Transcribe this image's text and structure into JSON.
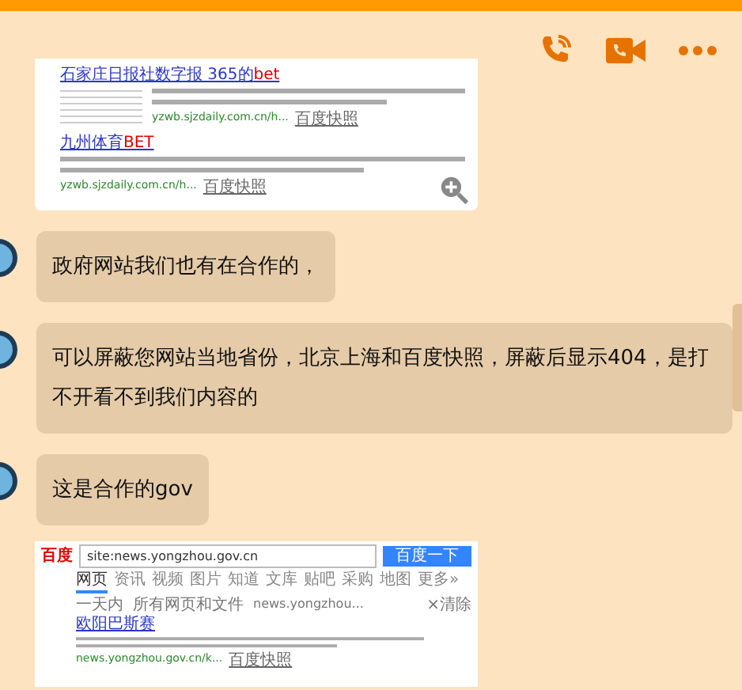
{
  "messages": [
    {
      "kind": "image",
      "shot": {
        "kind": "results",
        "results": [
          {
            "title": "石家庄日报社数字报 365的",
            "title_mark": "bet",
            "has_thumb": true,
            "url": "yzwb.sjzdaily.com.cn/h...",
            "cache": "百度快照"
          },
          {
            "title": "九州体育",
            "title_mark": "BET",
            "has_thumb": false,
            "url": "yzwb.sjzdaily.com.cn/h...",
            "cache": "百度快照"
          }
        ]
      }
    },
    {
      "kind": "text",
      "text": "政府网站我们也有在合作的，"
    },
    {
      "kind": "text",
      "text": "可以屏蔽您网站当地省份，北京上海和百度快照，屏蔽后显示404，是打不开看不到我们内容的"
    },
    {
      "kind": "text",
      "text": "这是合作的gov"
    },
    {
      "kind": "image",
      "shot": {
        "kind": "search",
        "logo": "百度",
        "query": "site:news.yongzhou.gov.cn",
        "button": "百度一下",
        "tabs": [
          {
            "label": "网页",
            "selected": true
          },
          {
            "label": "资讯",
            "selected": false
          },
          {
            "label": "视频",
            "selected": false
          },
          {
            "label": "图片",
            "selected": false
          },
          {
            "label": "知道",
            "selected": false
          },
          {
            "label": "文库",
            "selected": false
          },
          {
            "label": "贴吧",
            "selected": false
          },
          {
            "label": "采购",
            "selected": false
          },
          {
            "label": "地图",
            "selected": false
          },
          {
            "label": "更多»",
            "selected": false
          }
        ],
        "filters": [
          "一天内",
          "所有网页和文件",
          "news.yongzhou..."
        ],
        "clear": "×清除",
        "result": {
          "title": "欧阳巴斯赛",
          "url": "news.yongzhou.gov.cn/k...",
          "cache": "百度快照"
        }
      }
    }
  ]
}
